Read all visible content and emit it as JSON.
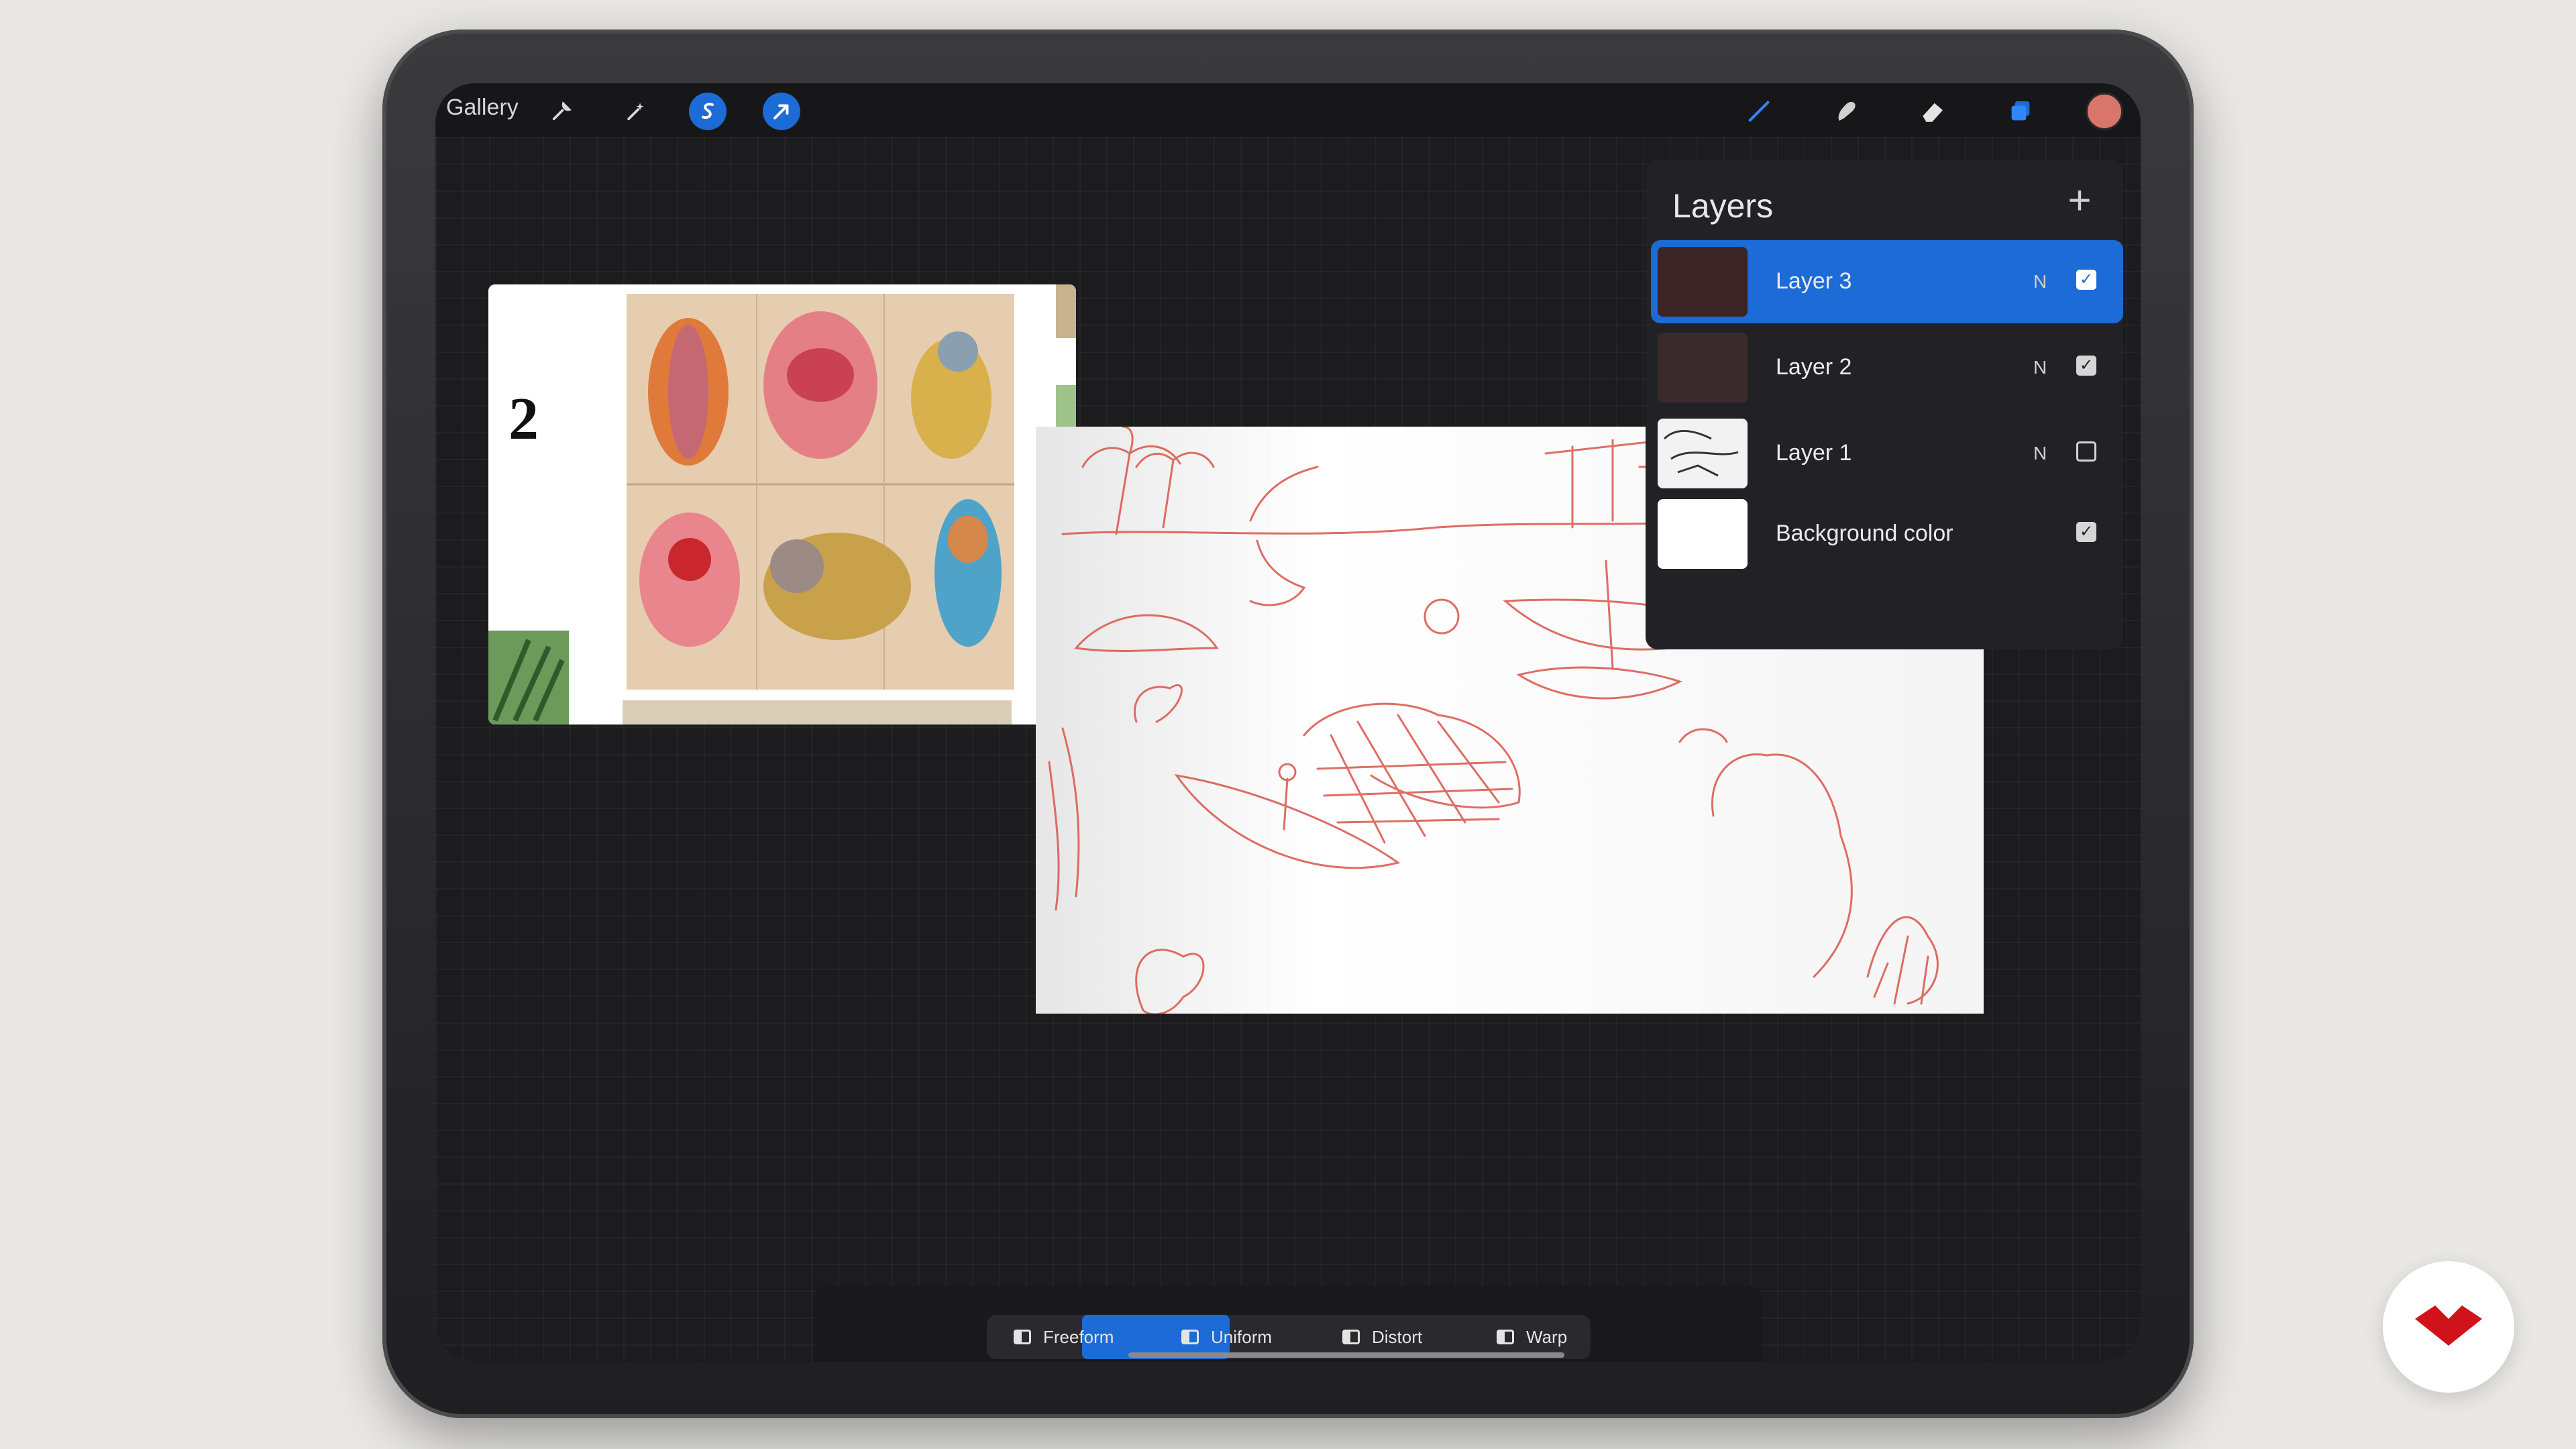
{
  "toolbar": {
    "gallery_label": "Gallery",
    "left_icons": [
      "wrench-icon",
      "magic-wand-icon",
      "selection-icon",
      "transform-arrow-icon"
    ],
    "right_icons": [
      "brush-icon",
      "smudge-icon",
      "eraser-icon",
      "layers-icon"
    ],
    "active_color": "#d9766b"
  },
  "layers_panel": {
    "title": "Layers",
    "add_label": "+",
    "layers": [
      {
        "name": "Layer 3",
        "mode": "N",
        "visible": true,
        "active": true
      },
      {
        "name": "Layer 2",
        "mode": "N",
        "visible": true,
        "active": false
      },
      {
        "name": "Layer 1",
        "mode": "N",
        "visible": false,
        "active": false
      },
      {
        "name": "Background color",
        "mode": "",
        "visible": true,
        "active": false
      }
    ]
  },
  "transform_modes": {
    "options": [
      "Freeform",
      "Uniform",
      "Distort",
      "Warp"
    ],
    "selected": "Uniform"
  },
  "reference_image": {
    "visible_text": "2"
  },
  "colors": {
    "accent": "#1c6bd6",
    "sketch_red": "#d9554a",
    "brand_red": "#d0121a"
  }
}
